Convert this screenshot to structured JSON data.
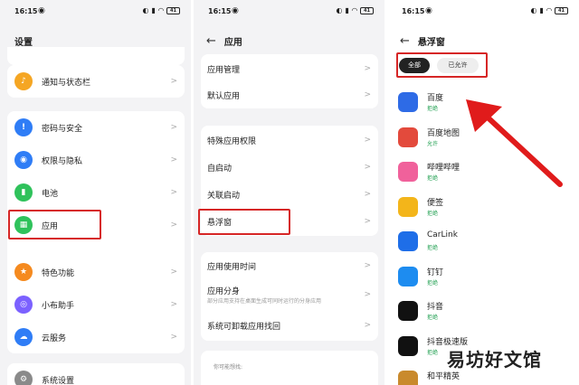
{
  "status": {
    "time": "16:15",
    "weibo_icon": "weibo-icon",
    "battery": "41"
  },
  "s1": {
    "title": "设置",
    "items": [
      {
        "label": "通知与状态栏",
        "color": "#f5a623",
        "icon": "bell-icon"
      },
      {
        "label": "密码与安全",
        "color": "#2f7df6",
        "icon": "shield-icon"
      },
      {
        "label": "权限与隐私",
        "color": "#2f7df6",
        "icon": "eye-icon"
      },
      {
        "label": "电池",
        "color": "#2fc25b",
        "icon": "battery-icon"
      },
      {
        "label": "应用",
        "color": "#2fc25b",
        "icon": "apps-icon"
      },
      {
        "label": "特色功能",
        "color": "#f58a1f",
        "icon": "star-icon"
      },
      {
        "label": "小布助手",
        "color": "#7b61ff",
        "icon": "assistant-icon"
      },
      {
        "label": "云服务",
        "color": "#2f7df6",
        "icon": "cloud-icon"
      },
      {
        "label": "系统设置",
        "color": "#8a8a8a",
        "icon": "gear-icon"
      }
    ]
  },
  "s2": {
    "title": "应用",
    "group1": [
      "应用管理",
      "默认应用"
    ],
    "group2": [
      "特殊应用权限",
      "自启动",
      "关联启动",
      "悬浮窗"
    ],
    "group3": [
      {
        "label": "应用使用时间",
        "sub": ""
      },
      {
        "label": "应用分身",
        "sub": "部分应用支持在桌面生成可同时运行的分身应用"
      },
      {
        "label": "系统可卸载应用找回",
        "sub": ""
      }
    ],
    "suggest": "你可能想找:"
  },
  "s3": {
    "title": "悬浮窗",
    "tab_all": "全部",
    "tab_allowed": "已允许",
    "apps": [
      {
        "name": "百度",
        "status": "拒绝",
        "color": "#2e6be6",
        "icon": "baidu-icon"
      },
      {
        "name": "百度地图",
        "status": "允许",
        "color": "#e34a3c",
        "icon": "map-pin-icon"
      },
      {
        "name": "哔哩哔哩",
        "status": "拒绝",
        "color": "#f0619b",
        "icon": "bilibili-icon"
      },
      {
        "name": "便签",
        "status": "拒绝",
        "color": "#f3b51a",
        "icon": "notes-icon"
      },
      {
        "name": "CarLink",
        "status": "拒绝",
        "color": "#1e6ee8",
        "icon": "car-icon"
      },
      {
        "name": "钉钉",
        "status": "拒绝",
        "color": "#1d8cf0",
        "icon": "dingtalk-icon"
      },
      {
        "name": "抖音",
        "status": "拒绝",
        "color": "#111111",
        "icon": "douyin-icon"
      },
      {
        "name": "抖音极速版",
        "status": "拒绝",
        "color": "#111111",
        "icon": "douyin-lite-icon"
      },
      {
        "name": "和平精英",
        "status": "",
        "color": "#c98a2d",
        "icon": "game-icon"
      }
    ]
  },
  "watermark": "易坊好文馆",
  "accent_red": "#d62626"
}
